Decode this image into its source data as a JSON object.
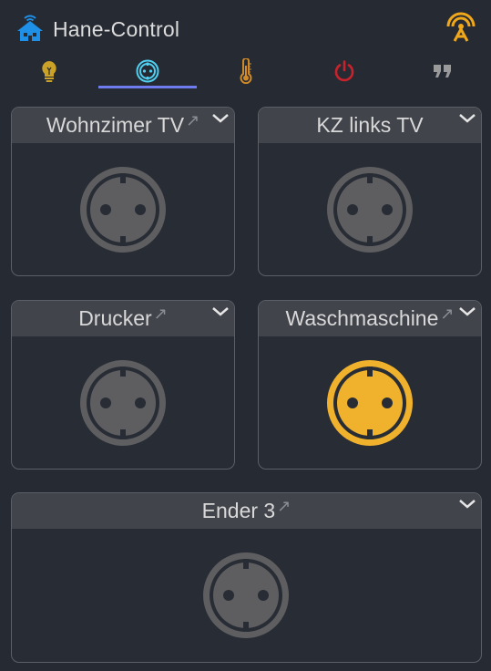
{
  "app": {
    "title": "Hane-Control",
    "brand_color": "#1e90e8",
    "signal_color": "#f0a81a"
  },
  "tabs": [
    {
      "name": "lightbulb-icon",
      "color": "#c9a227",
      "active": false
    },
    {
      "name": "socket-icon",
      "color": "#4fd0f0",
      "active": true
    },
    {
      "name": "thermometer-icon",
      "color": "#d08a28",
      "active": false
    },
    {
      "name": "power-icon",
      "color": "#c8232c",
      "active": false
    },
    {
      "name": "quote-icon",
      "color": "#9a9a9a",
      "active": false
    }
  ],
  "cards": [
    {
      "label": "Wohnzimer TV",
      "on": false
    },
    {
      "label": "KZ links TV",
      "on": false
    },
    {
      "label": "Drucker",
      "on": false
    },
    {
      "label": "Waschmaschine",
      "on": true
    },
    {
      "label": "Ender 3",
      "on": false
    }
  ],
  "colors": {
    "socket_off": "#5e5e60",
    "socket_off_ring": "#5e5e60",
    "socket_on": "#f0b22c",
    "active_tab_underline": "#6f7cf0"
  }
}
